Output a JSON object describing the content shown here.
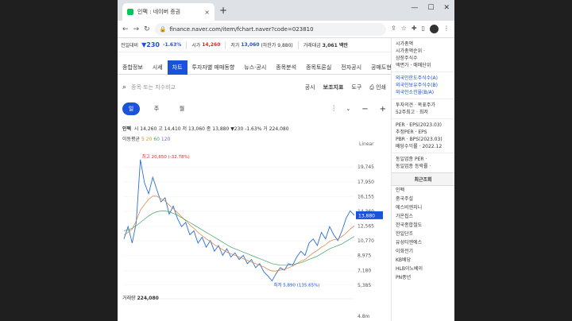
{
  "browser": {
    "tab_title": "인펙 : 네이버 증권",
    "url": "finance.naver.com/item/fchart.naver?code=023810",
    "newtab_label": "+",
    "close_label": "×",
    "min_label": "—",
    "max_label": "☐",
    "winclose_label": "✕"
  },
  "pricebar": {
    "prev_label": "전일대비",
    "current": "▼230",
    "change_pct": "-1.63%",
    "open_label": "시가",
    "open": "14,260",
    "low_label": "저가",
    "low": "13,060",
    "low_limit": "(하한가 9,880)",
    "amount_label": "거래대금",
    "amount": "3,061 백만"
  },
  "menu": [
    "종합정보",
    "시세",
    "차트",
    "투자자별 매매동향",
    "뉴스·공시",
    "종목분석",
    "종목토론실",
    "전자공시",
    "공매도현황"
  ],
  "menu_active": 2,
  "search": {
    "placeholder": "종목 또는 지수비교",
    "tools": [
      "공시",
      "보조지표",
      "도구",
      "인쇄"
    ]
  },
  "period": [
    "일",
    "주",
    "월"
  ],
  "period_active": 0,
  "ohlc": {
    "name": "인펙",
    "text": "시 14,260  고 14,410  저 13,060  종 13,880 ▼230 -1.63%  거 224,080"
  },
  "ma": {
    "label": "이동평균",
    "m5": "5",
    "m20": "20",
    "m60": "60",
    "m120": "120"
  },
  "linear": "Linear",
  "chart_data": {
    "type": "line",
    "title": "",
    "yticks": [
      "19,745",
      "17,950",
      "16,155",
      "14,360",
      "12,565",
      "10,770",
      "8,975",
      "7,180",
      "5,385"
    ],
    "ylim": [
      4500,
      21500
    ],
    "high_annotation": "최고 20,650 (-32.78%)",
    "low_annotation": "최저 5,890 (135.65%)",
    "current_label": "13,880",
    "series": [
      {
        "values": [
          11000,
          12500,
          10500,
          13000,
          20650,
          17800,
          16500,
          18500,
          17000,
          15500,
          16000,
          14000,
          15000,
          13500,
          12500,
          13000,
          11500,
          12000,
          10500,
          11200,
          10000,
          10800,
          9500,
          10200,
          9000,
          9800,
          8800,
          9300,
          8500,
          9000,
          8000,
          8500,
          7500,
          8000,
          7000,
          6500,
          5890,
          6800,
          7500,
          7200,
          8000,
          7800,
          8800,
          9500,
          9000,
          10500,
          11000,
          10200,
          11800,
          11000,
          12500,
          11500,
          10800,
          12000,
          13500,
          14410,
          13880
        ]
      },
      {
        "values": [
          11500,
          11800,
          12200,
          13200,
          14500,
          15200,
          15800,
          16200,
          16200,
          15900,
          15600,
          15100,
          14700,
          14200,
          13700,
          13200,
          12700,
          12300,
          11800,
          11400,
          11000,
          10700,
          10300,
          10000,
          9700,
          9400,
          9200,
          9000,
          8800,
          8600,
          8400,
          8200,
          8000,
          7800,
          7600,
          7300,
          7100,
          7100,
          7200,
          7300,
          7500,
          7700,
          8000,
          8300,
          8500,
          8900,
          9300,
          9600,
          10000,
          10300,
          10700,
          10900,
          11000,
          11300,
          11700,
          12200,
          12600
        ]
      },
      {
        "values": [
          12000,
          12100,
          12300,
          12600,
          13000,
          13400,
          13800,
          14100,
          14300,
          14400,
          14400,
          14300,
          14100,
          13900,
          13600,
          13300,
          13000,
          12700,
          12400,
          12100,
          11800,
          11500,
          11200,
          10900,
          10600,
          10300,
          10000,
          9800,
          9600,
          9400,
          9200,
          9000,
          8800,
          8600,
          8400,
          8200,
          8000,
          7900,
          7800,
          7800,
          7800,
          7900,
          8000,
          8100,
          8300,
          8500,
          8700,
          8900,
          9200,
          9500,
          9800,
          10000,
          10200,
          10400,
          10700,
          11000,
          11300
        ]
      }
    ],
    "volume_label": "거래량",
    "volume_value": "224,080",
    "volume_tick": "4.8m"
  },
  "side": {
    "top": [
      "시가총액",
      "시가총액순위 ·",
      "상장주식수",
      "액면가 · 매매단위"
    ],
    "foreign": [
      "외국인한도주식수(A)",
      "외국인보유주식수(B)",
      "외국인소진율(B/A)"
    ],
    "opinion": [
      "투자의견 · 목표주가",
      "52주최고 · 최저"
    ],
    "per": [
      "PER · EPS(2023.03)",
      "추정PER · EPS",
      "PBR · BPS(2023.03)",
      "배당수익률 · 2022.12"
    ],
    "industry": [
      "동일업종 PER ·",
      "동일업종 등락률 ·"
    ],
    "recent_title": "최근조회",
    "recent": [
      "인펙",
      "중국주설",
      "에스비엔지니",
      "가온칩스",
      "한국종합철도",
      "한일단조",
      "유성티엔에스",
      "이화전기",
      "KB배당",
      "HLB이노베이",
      "PN풍년"
    ]
  }
}
